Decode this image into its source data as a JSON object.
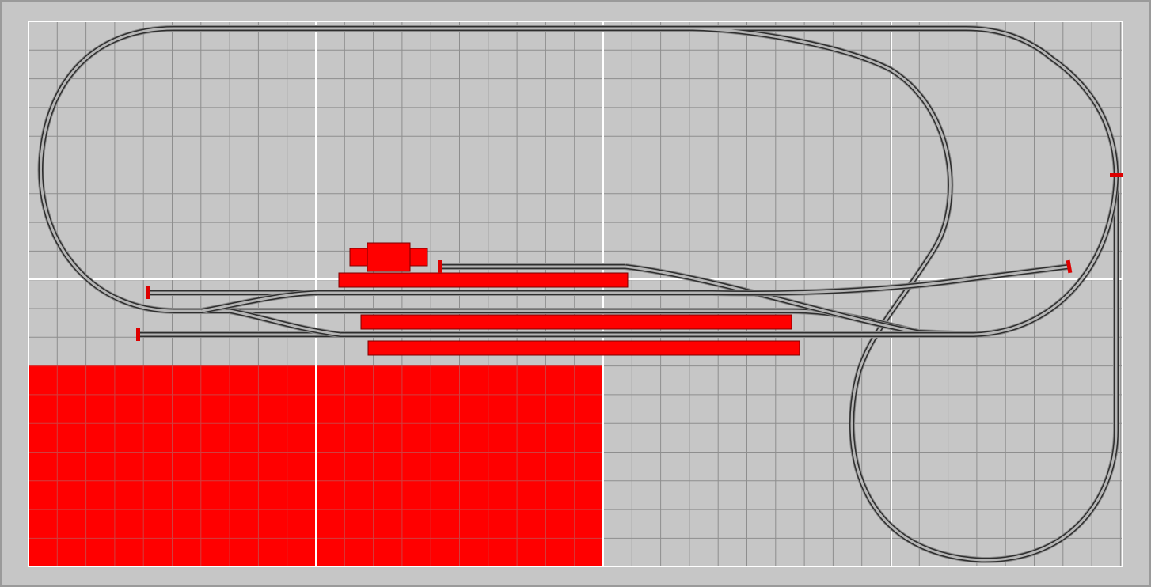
{
  "colors": {
    "background": "#c6c6c6",
    "grid_minor": "#8e8e8e",
    "grid_major": "#ffffff",
    "board_border": "#ffffff",
    "outer_border": "#9a9a9a",
    "track_bed": "#8a8a8a",
    "track_rail": "#2e2e2e",
    "track_center": "#b5b5b5",
    "structure_fill": "#ff0000",
    "structure_stroke": "#7a0000",
    "buffer_stop": "#dd0000"
  },
  "icons": {
    "buffer_stop": "buffer-stop-icon"
  }
}
